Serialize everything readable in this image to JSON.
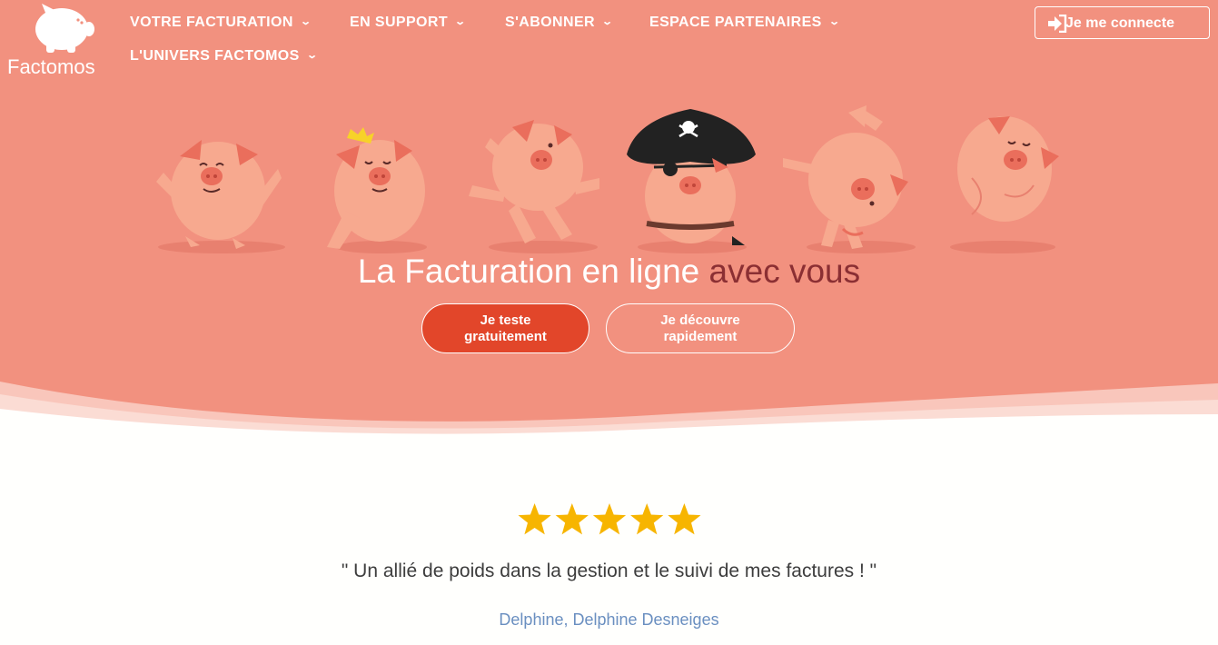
{
  "brand": {
    "name": "Factomos"
  },
  "nav": {
    "items": [
      {
        "label": "VOTRE FACTURATION"
      },
      {
        "label": "EN SUPPORT"
      },
      {
        "label": "S'ABONNER"
      },
      {
        "label": "ESPACE PARTENAIRES"
      },
      {
        "label": "L'UNIVERS FACTOMOS"
      }
    ],
    "login_label": "Je me connecte"
  },
  "hero": {
    "headline": "La Facturation en ligne",
    "headline_accent": "avec vous",
    "cta_primary": "Je teste gratuitement",
    "cta_secondary": "Je découvre rapidement"
  },
  "testimonial": {
    "rating": 5,
    "rating_max": 5,
    "quote": "\" Un allié de poids dans la gestion et le suivi de mes factures ! \"",
    "author": "Delphine, Delphine Desneiges"
  },
  "colors": {
    "hero_bg": "#f2917f",
    "cta_primary": "#e2462a",
    "headline_accent": "#8b2f33",
    "star": "#f7b500",
    "author": "#6a8fc0"
  },
  "icons": [
    "piggy-bank-logo-icon",
    "chevron-down-icon",
    "sign-in-icon",
    "star-icon"
  ]
}
